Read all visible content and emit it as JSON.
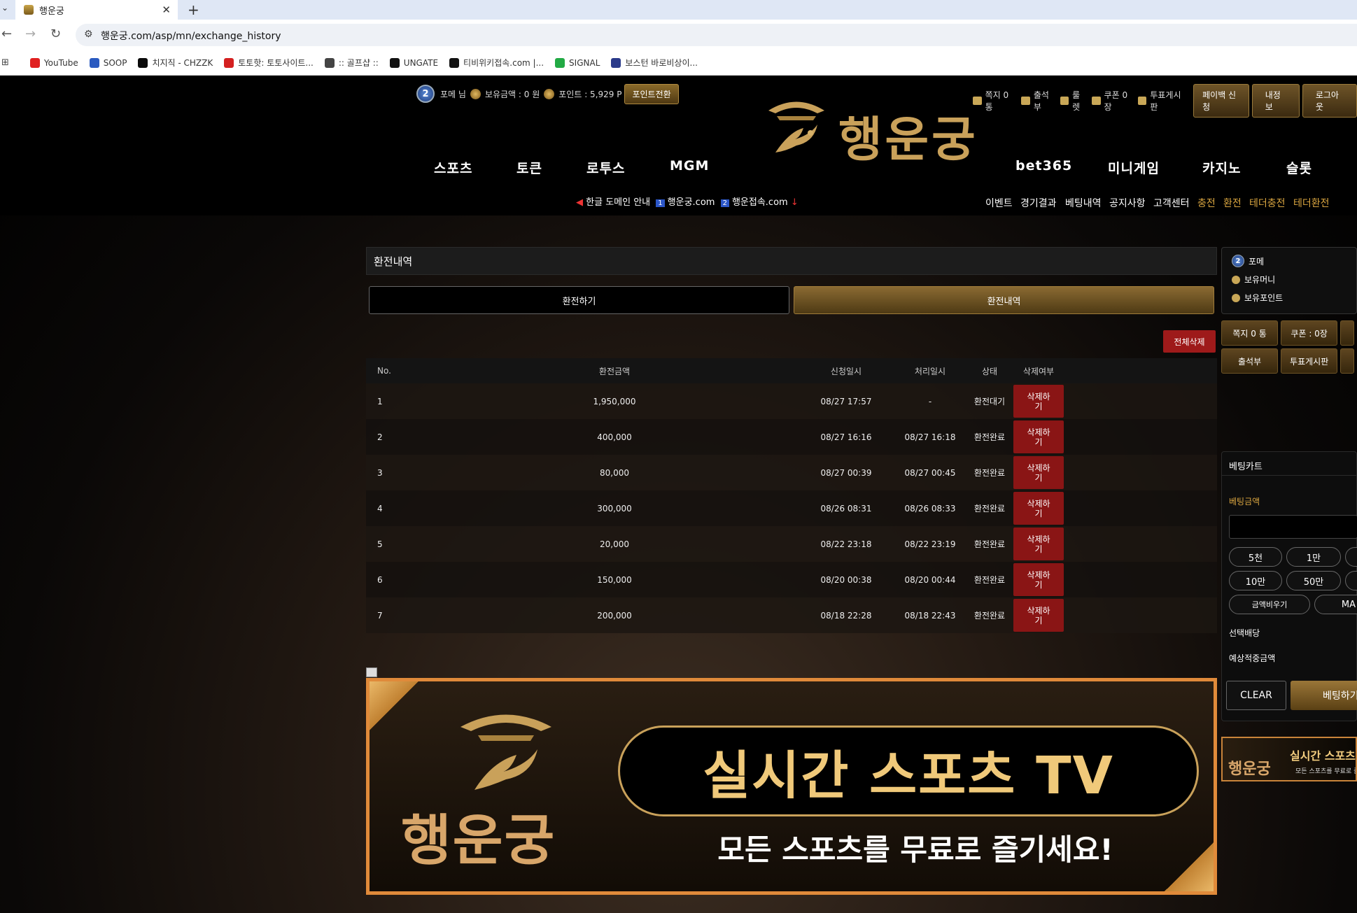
{
  "browser": {
    "tab_title": "행운궁",
    "url": "행운궁.com/asp/mn/exchange_history",
    "bookmarks": [
      "YouTube",
      "SOOP",
      "치지직 - CHZZK",
      "토토핫: 토토사이트...",
      ":: 골프샵 ::",
      "UNGATE",
      "티비위키접속.com |...",
      "SIGNAL",
      "보스턴 바로비상이..."
    ],
    "bookmark_colors": [
      "#e02020",
      "#2a5ac0",
      "#0a0a0a",
      "#d42020",
      "#444444",
      "#111111",
      "#111111",
      "#22aa44",
      "#2a3a8a"
    ]
  },
  "header": {
    "level": "2",
    "user": "포메 님",
    "balance": "보유금액 : 0 원",
    "points": "포인트 : 5,929 P",
    "point_convert": "포인트전환",
    "messages": "쪽지 0 통",
    "attendance": "출석부",
    "roulette": "룰렛",
    "coupons": "쿠폰 0장",
    "vote_board": "투표게시판",
    "payback": "페이백 신청",
    "my_info": "내정보",
    "logout": "로그아웃",
    "logo_text": "행운궁"
  },
  "main_nav": [
    "스포츠",
    "토큰",
    "로투스",
    "MGM",
    "bet365",
    "미니게임",
    "카지노",
    "슬롯"
  ],
  "notice": {
    "prefix": "한글 도메인 안내",
    "n1": "1",
    "d1": "행운궁.com",
    "n2": "2",
    "d2": "행운접속.com"
  },
  "sub_nav": [
    "이벤트",
    "경기결과",
    "베팅내역",
    "공지사항",
    "고객센터",
    "충전",
    "환전",
    "테더충전",
    "테더환전"
  ],
  "panel": {
    "title": "환전내역",
    "tab_exchange": "환전하기",
    "tab_history": "환전내역",
    "delete_all": "전체삭제"
  },
  "table": {
    "headers": [
      "No.",
      "환전금액",
      "신청일시",
      "처리일시",
      "상태",
      "삭제여부"
    ],
    "rows": [
      {
        "no": "1",
        "amount": "1,950,000",
        "requested": "08/27 17:57",
        "processed": "-",
        "status": "환전대기",
        "del": "삭제하기"
      },
      {
        "no": "2",
        "amount": "400,000",
        "requested": "08/27 16:16",
        "processed": "08/27 16:18",
        "status": "환전완료",
        "del": "삭제하기"
      },
      {
        "no": "3",
        "amount": "80,000",
        "requested": "08/27 00:39",
        "processed": "08/27 00:45",
        "status": "환전완료",
        "del": "삭제하기"
      },
      {
        "no": "4",
        "amount": "300,000",
        "requested": "08/26 08:31",
        "processed": "08/26 08:33",
        "status": "환전완료",
        "del": "삭제하기"
      },
      {
        "no": "5",
        "amount": "20,000",
        "requested": "08/22 23:18",
        "processed": "08/22 23:19",
        "status": "환전완료",
        "del": "삭제하기"
      },
      {
        "no": "6",
        "amount": "150,000",
        "requested": "08/20 00:38",
        "processed": "08/20 00:44",
        "status": "환전완료",
        "del": "삭제하기"
      },
      {
        "no": "7",
        "amount": "200,000",
        "requested": "08/18 22:28",
        "processed": "08/18 22:43",
        "status": "환전완료",
        "del": "삭제하기"
      }
    ]
  },
  "banner": {
    "logo": "행운궁",
    "title": "실시간 스포츠 TV",
    "subtitle": "모든 스포츠를 무료로 즐기세요!"
  },
  "sidebar": {
    "level": "2",
    "user": "포메",
    "money_label": "보유머니",
    "point_label": "보유포인트",
    "msg_btn": "쪽지 0 통",
    "coupon_btn": "쿠폰 : 0장",
    "attendance_btn": "출석부",
    "vote_btn": "투표게시판",
    "betcart_title": "베팅카트",
    "bet_amount_label": "베팅금액",
    "chips": [
      "5천",
      "1만",
      "10만",
      "50만"
    ],
    "clear_amount": "금액비우기",
    "max": "MA",
    "selected_odds": "선택배당",
    "expected_win": "예상적중금액",
    "clear": "CLEAR",
    "bet": "베팅하기",
    "mini_banner_title": "실시간 스포츠",
    "mini_banner_sub": "모든 스포츠를 무료로 즐",
    "mini_banner_logo": "행운궁"
  },
  "colors": {
    "gold": "#c9a15a",
    "accent_orange": "#d9a540",
    "delete_red": "#8a1515",
    "banner_border": "#e08a3a"
  }
}
